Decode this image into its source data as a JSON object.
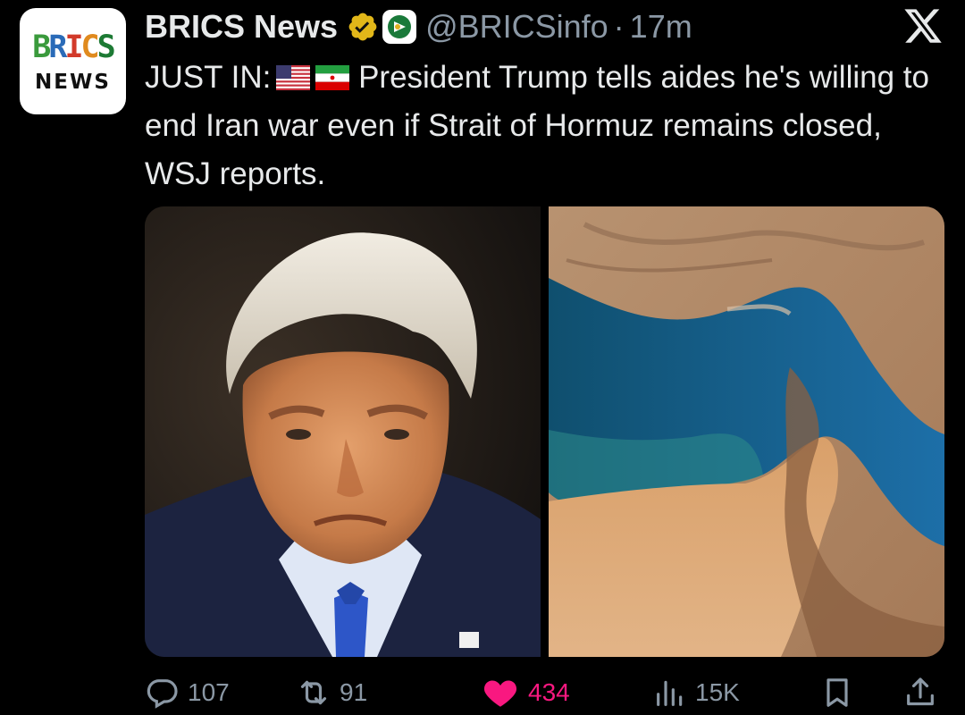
{
  "avatar": {
    "line1": [
      "B",
      "R",
      "I",
      "C",
      "S"
    ],
    "line2": "NEWS"
  },
  "author": {
    "display_name": "BRICS News",
    "handle": "@BRICSinfo",
    "separator": "·",
    "time": "17m",
    "verified_color": "#e2b719"
  },
  "tweet": {
    "prefix": "JUST IN:",
    "flags": [
      "us-flag-icon",
      "iran-flag-icon"
    ],
    "body": "President Trump tells aides he's willing to end Iran war even if Strait of Hormuz remains closed, WSJ reports."
  },
  "media": {
    "left": "portrait-photo",
    "right": "satellite-photo"
  },
  "actions": {
    "replies": "107",
    "reposts": "91",
    "likes": "434",
    "views": "15K"
  },
  "colors": {
    "background": "#000000",
    "text": "#e7e9ea",
    "muted": "#8b98a5",
    "like": "#f91880"
  }
}
